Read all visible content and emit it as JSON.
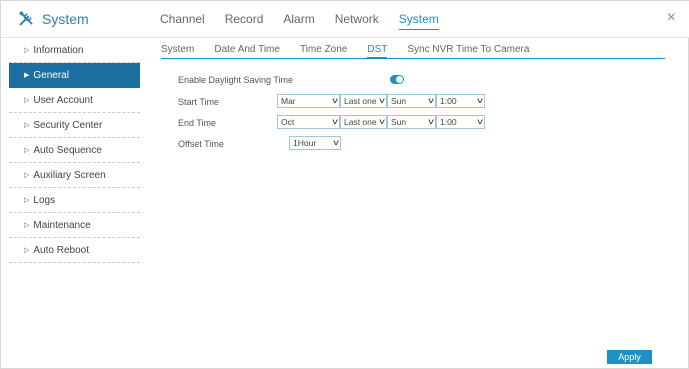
{
  "header": {
    "brand_icon": "tools-icon",
    "title": "System",
    "nav": [
      "Channel",
      "Record",
      "Alarm",
      "Network",
      "System"
    ],
    "active_nav": "System",
    "close_label": "×"
  },
  "sidebar": {
    "items": [
      {
        "label": "Information"
      },
      {
        "label": "General"
      },
      {
        "label": "User Account"
      },
      {
        "label": "Security Center"
      },
      {
        "label": "Auto Sequence"
      },
      {
        "label": "Auxiliary Screen"
      },
      {
        "label": "Logs"
      },
      {
        "label": "Maintenance"
      },
      {
        "label": "Auto Reboot"
      }
    ],
    "active": "General"
  },
  "sub_tabs": [
    "System",
    "Date And Time",
    "Time Zone",
    "DST",
    "Sync NVR Time To Camera"
  ],
  "active_sub_tab": "DST",
  "form": {
    "enable_label": "Enable Daylight Saving Time",
    "enable_value": true,
    "start_label": "Start Time",
    "start": {
      "month": "Mar",
      "week": "Last one",
      "day": "Sun",
      "time": "1:00"
    },
    "end_label": "End Time",
    "end": {
      "month": "Oct",
      "week": "Last one",
      "day": "Sun",
      "time": "1:00"
    },
    "offset_label": "Offset Time",
    "offset": "1Hour"
  },
  "apply_label": "Apply",
  "colors": {
    "accent": "#1e90c8",
    "sidebar_active": "#1a6fa0",
    "brand": "#2f7fb0"
  }
}
